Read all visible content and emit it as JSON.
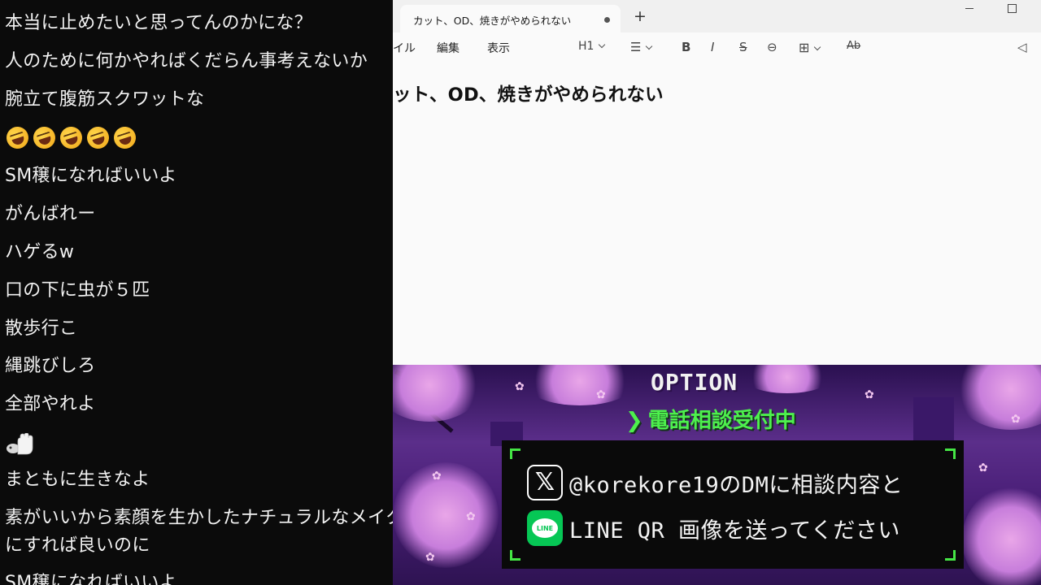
{
  "chat": {
    "messages": [
      "本当に止めたいと思ってんのかにな？",
      "人のために何かやればくだらん事考えないか",
      "腕立て腹筋スクワットな",
      "SM穣になればいいよ",
      "がんばれー",
      "ハゲるw",
      "口の下に虫が５匹",
      "散歩行こ",
      "縄跳びしろ",
      "全部やれよ",
      "まともに生きなよ",
      "素がいいから素顔を生かしたナチュラルなメイク",
      "にすれば良いのに",
      "SM穣になればいいよ"
    ],
    "emoji_row": [
      "rolling-on-floor-laughing",
      "rolling-on-floor-laughing",
      "rolling-on-floor-laughing",
      "rolling-on-floor-laughing",
      "rolling-on-floor-laughing"
    ],
    "wave_emoji": "waving-hand"
  },
  "editor": {
    "tab_title": "カット、OD、焼きがやめられない",
    "new_tab_label": "+",
    "menu": {
      "file": "イル",
      "edit": "編集",
      "view": "表示"
    },
    "toolbar": {
      "heading": "H1",
      "list": "☰",
      "bold": "B",
      "italic": "I",
      "strike": "S",
      "link": "⊖",
      "table": "⊞",
      "spell": "Ab",
      "announce": "◁"
    },
    "document_heading": "ット、OD、焼きがやめられない"
  },
  "banner": {
    "title": "OPTION",
    "subtitle_arrow": "❯",
    "subtitle": "電話相談受付中",
    "x_icon": "𝕏",
    "line_icon_label": "LINE",
    "row1_text": "@korekore19のDMに相談内容と",
    "row2_text": "LINE QR 画像を送ってください",
    "accent_green": "#4df04d",
    "line_green": "#06c755"
  }
}
